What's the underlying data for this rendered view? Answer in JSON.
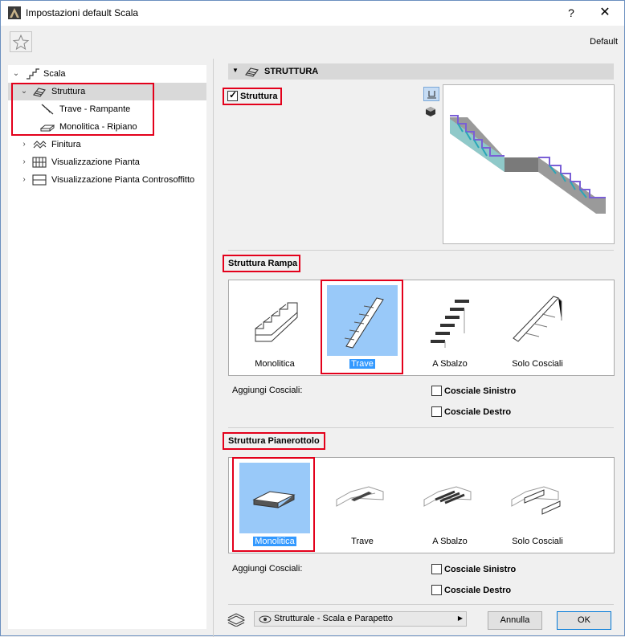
{
  "window": {
    "title": "Impostazioni default Scala",
    "help": "?",
    "close": "✕"
  },
  "toolbar": {
    "favorite_icon": "star-icon",
    "default_label": "Default"
  },
  "tree": {
    "items": [
      {
        "label": "Scala"
      },
      {
        "label": "Struttura"
      },
      {
        "label": "Trave - Rampante"
      },
      {
        "label": "Monolitica - Ripiano"
      },
      {
        "label": "Finitura"
      },
      {
        "label": "Visualizzazione Pianta"
      },
      {
        "label": "Visualizzazione Pianta Controsoffitto"
      }
    ]
  },
  "section": {
    "title": "STRUTTURA"
  },
  "struttura_checkbox": {
    "label": "Struttura",
    "checked": true
  },
  "rampa": {
    "heading": "Struttura Rampa",
    "options": [
      "Monolitica",
      "Trave",
      "A Sbalzo",
      "Solo Cosciali"
    ],
    "selected": "Trave",
    "add_label": "Aggiungi Cosciali:",
    "left_label": "Cosciale Sinistro",
    "right_label": "Cosciale Destro"
  },
  "pianerottolo": {
    "heading": "Struttura Pianerottolo",
    "options": [
      "Monolitica",
      "Trave",
      "A Sbalzo",
      "Solo Cosciali"
    ],
    "selected": "Monolitica",
    "add_label": "Aggiungi Cosciali:",
    "left_label": "Cosciale Sinistro",
    "right_label": "Cosciale Destro"
  },
  "footer": {
    "layer_value": "Strutturale - Scala e Parapetto",
    "cancel_label": "Annulla",
    "ok_label": "OK"
  },
  "colors": {
    "highlight": "#e3001b",
    "selection": "#3399ff",
    "selection_bg": "#99c9f9"
  }
}
